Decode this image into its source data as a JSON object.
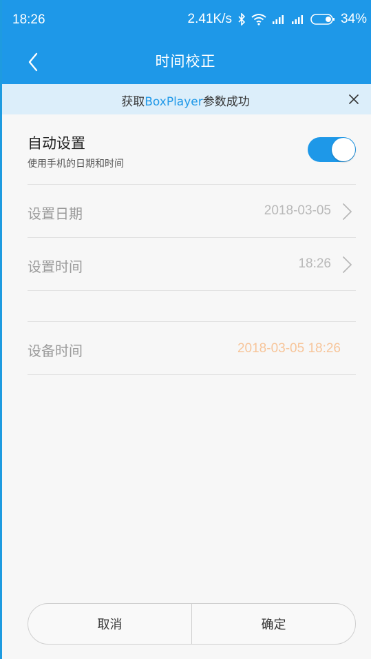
{
  "status_bar": {
    "time": "18:26",
    "net_speed": "2.41K/s",
    "battery": "34%"
  },
  "nav": {
    "title": "时间校正"
  },
  "banner": {
    "prefix": "获取",
    "highlight": "BoxPlayer",
    "suffix": "参数成功"
  },
  "auto": {
    "title": "自动设置",
    "subtitle": "使用手机的日期和时间",
    "enabled": true
  },
  "set_date": {
    "label": "设置日期",
    "value": "2018-03-05"
  },
  "set_time": {
    "label": "设置时间",
    "value": "18:26"
  },
  "device_time": {
    "label": "设备时间",
    "value": "2018-03-05 18:26"
  },
  "buttons": {
    "cancel": "取消",
    "confirm": "确定"
  },
  "colors": {
    "primary": "#1e98e8",
    "banner_bg": "#dceefa",
    "device_time_value": "#f7c59a"
  }
}
